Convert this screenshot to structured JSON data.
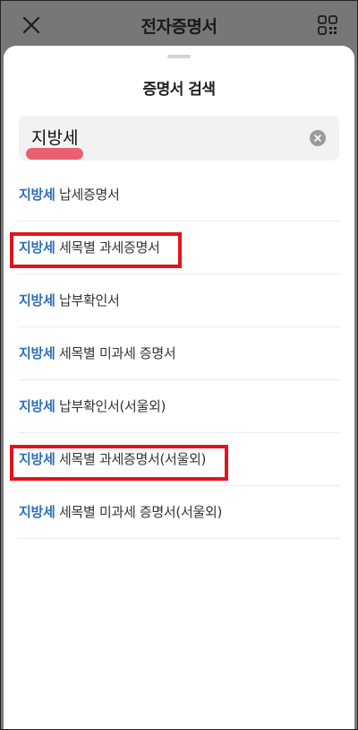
{
  "header": {
    "title": "전자증명서",
    "close_icon": "close-icon",
    "qr_icon": "qr-code-icon"
  },
  "sheet": {
    "title": "증명서 검색"
  },
  "search": {
    "value": "지방세",
    "clear_icon": "clear-icon",
    "underline_color": "#e8515f"
  },
  "results": [
    {
      "highlight": "지방세",
      "rest": "납세증명서",
      "boxed": false
    },
    {
      "highlight": "지방세",
      "rest": "세목별 과세증명서",
      "boxed": true
    },
    {
      "highlight": "지방세",
      "rest": "납부확인서",
      "boxed": false
    },
    {
      "highlight": "지방세",
      "rest": "세목별 미과세 증명서",
      "boxed": false
    },
    {
      "highlight": "지방세",
      "rest": "납부확인서(서울외)",
      "boxed": false
    },
    {
      "highlight": "지방세",
      "rest": "세목별 과세증명서(서울외)",
      "boxed": true
    },
    {
      "highlight": "지방세",
      "rest": "세목별 미과세 증명서(서울외)",
      "boxed": false
    }
  ],
  "colors": {
    "highlight": "#2f6fb5",
    "annotation_box": "#e0151c",
    "header_bg": "#777777"
  }
}
